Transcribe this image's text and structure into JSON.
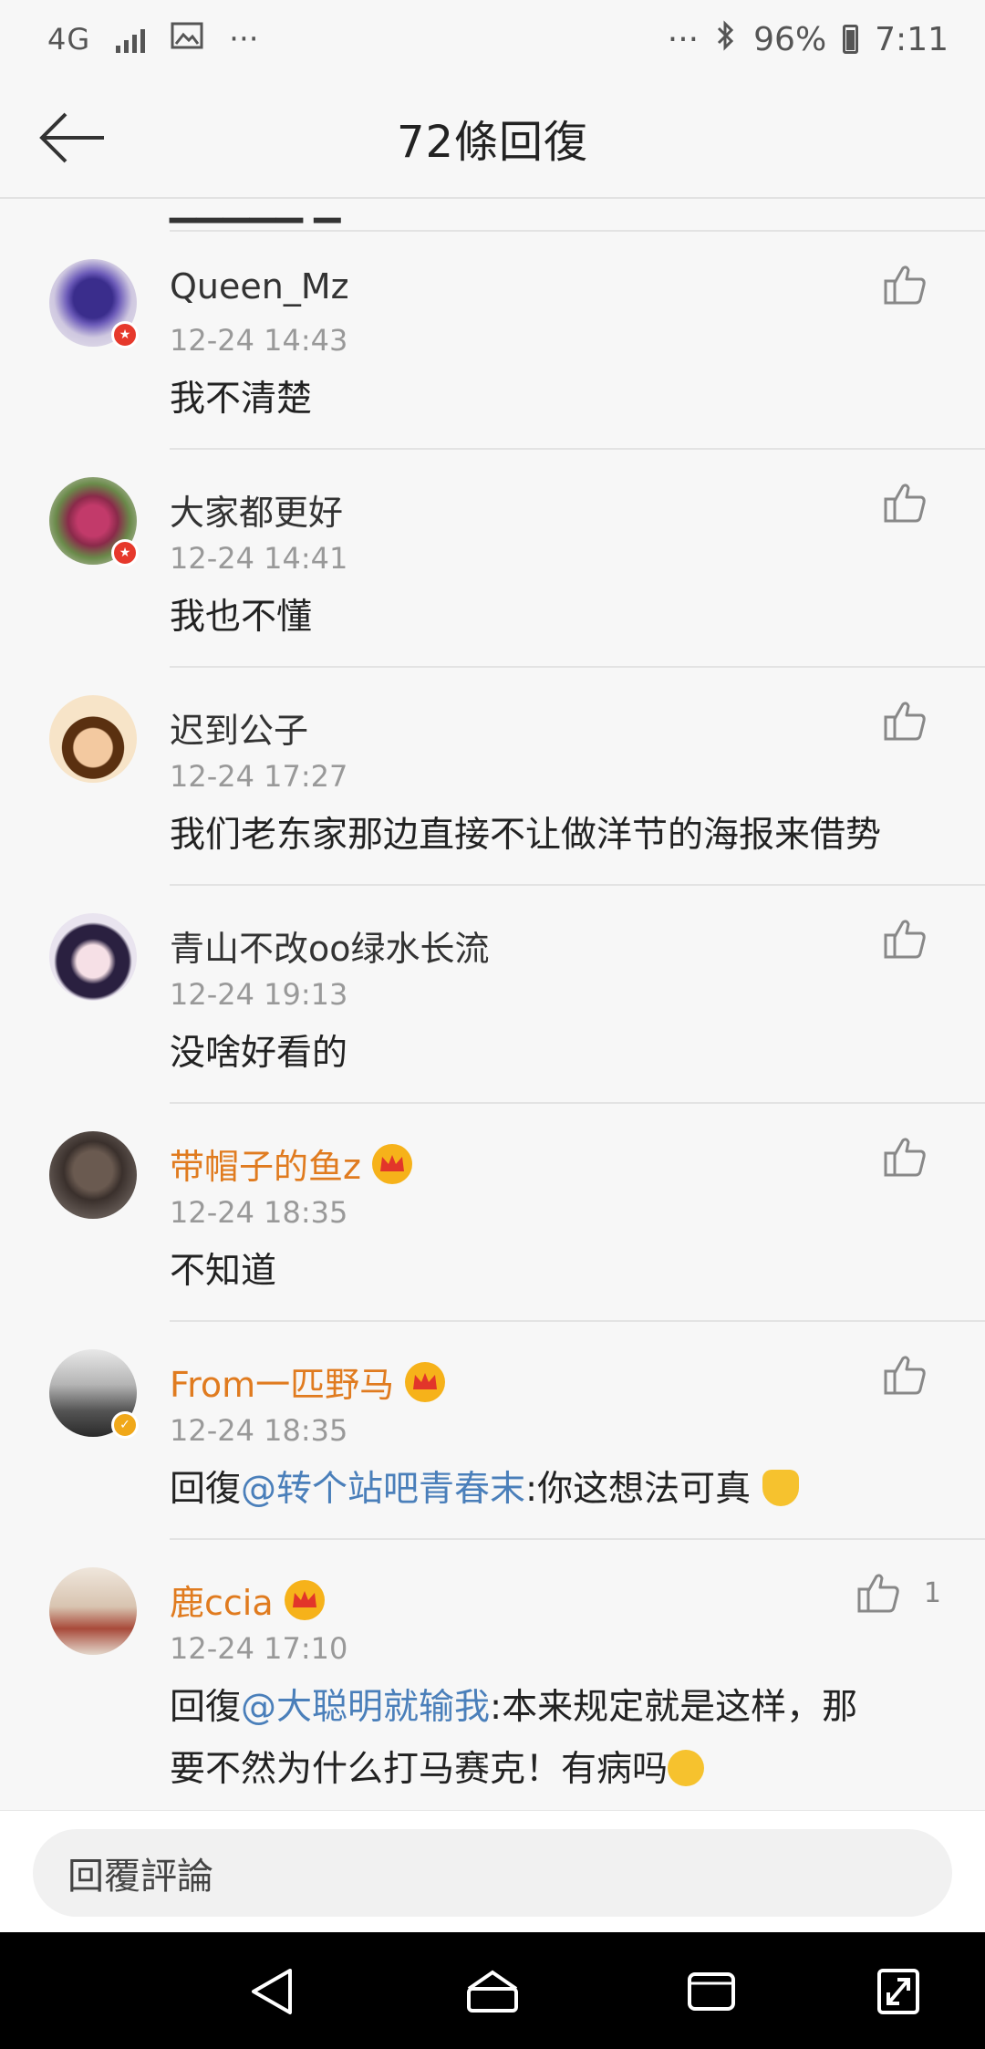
{
  "status_bar": {
    "network": "4G",
    "more": "···",
    "more_right": "···",
    "battery_percent": "96%",
    "time": "7:11"
  },
  "header": {
    "title": "72條回復"
  },
  "colors": {
    "vip_name": "#e07b1f",
    "mention": "#4a7fba",
    "timestamp": "#999999"
  },
  "comments": [
    {
      "username": "Queen_Mz",
      "timestamp": "12-24 14:43",
      "text": "我不清楚",
      "badge": "red"
    },
    {
      "username": "大家都更好",
      "timestamp": "12-24 14:41",
      "text": "我也不懂",
      "badge": "red"
    },
    {
      "username": "迟到公子",
      "timestamp": "12-24 17:27",
      "text": "我们老东家那边直接不让做洋节的海报来借势"
    },
    {
      "username": "青山不改oo绿水长流",
      "timestamp": "12-24 19:13",
      "text": "没啥好看的"
    },
    {
      "username": "带帽子的鱼z",
      "timestamp": "12-24 18:35",
      "text": "不知道",
      "vip": true
    },
    {
      "username": "From一匹野马",
      "timestamp": "12-24 18:35",
      "reply_prefix": "回復",
      "mention": "@转个站吧青春末",
      "text": ":你这想法可真",
      "vip": true,
      "badge": "gold"
    },
    {
      "username": "鹿ccia",
      "timestamp": "12-24 17:10",
      "reply_prefix": "回復",
      "mention": "@大聪明就输我",
      "text": ":本来规定就是这样，那",
      "text_line2": "要不然为什么打马赛克！有病吗",
      "vip": true,
      "like_count": "1"
    }
  ],
  "reply_bar": {
    "placeholder": "回覆評論"
  }
}
